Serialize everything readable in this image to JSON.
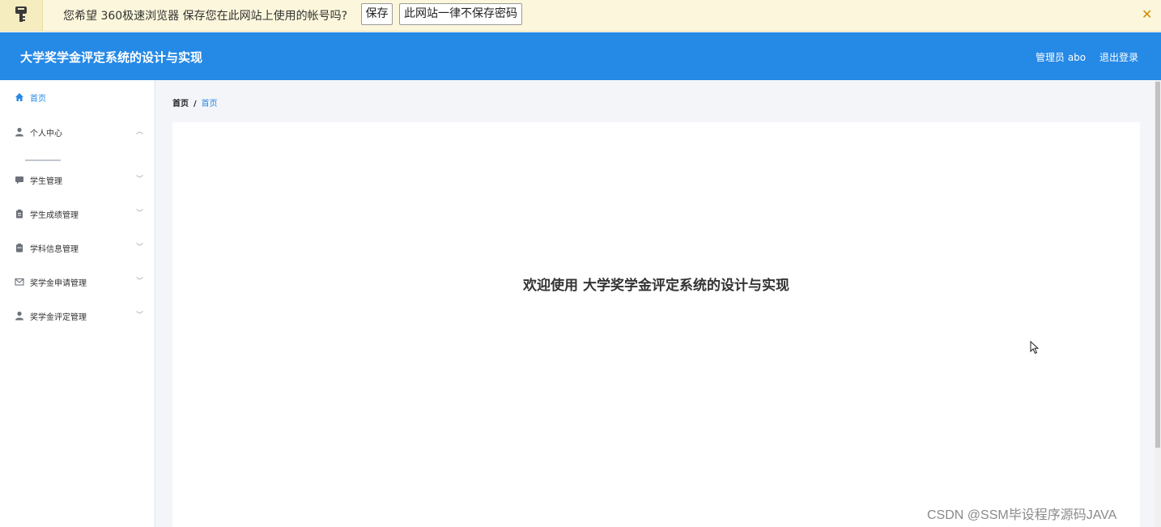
{
  "password_bar": {
    "message": "您希望 360极速浏览器 保存您在此网站上使用的帐号吗?",
    "save_label": "保存",
    "never_label": "此网站一律不保存密码",
    "close_label": "✕"
  },
  "header": {
    "title": "大学奖学金评定系统的设计与实现",
    "admin_label": "管理员 abo",
    "logout_label": "退出登录",
    "bg_color": "#2589e6"
  },
  "sidebar": {
    "items": [
      {
        "label": "首页",
        "icon": "home-icon",
        "active": true
      },
      {
        "label": "个人中心",
        "icon": "user-icon",
        "expanded": true
      },
      {
        "label": "学生管理",
        "icon": "chat-icon"
      },
      {
        "label": "学生成绩管理",
        "icon": "clipboard-icon"
      },
      {
        "label": "学科信息管理",
        "icon": "document-icon"
      },
      {
        "label": "奖学金申请管理",
        "icon": "mail-icon"
      },
      {
        "label": "奖学金评定管理",
        "icon": "user-icon"
      }
    ]
  },
  "breadcrumb": {
    "root": "首页",
    "separator": "/",
    "current": "首页"
  },
  "main": {
    "welcome": "欢迎使用 大学奖学金评定系统的设计与实现"
  },
  "watermark": "CSDN @SSM毕设程序源码JAVA"
}
